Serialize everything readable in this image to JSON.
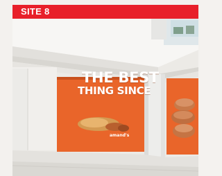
{
  "banner": {
    "label": "SITE 8",
    "color": "#e8202a"
  },
  "advert": {
    "headline_line1": "THE BEST",
    "headline_line2": "THING SINCE",
    "brand": "amand's",
    "color": "#e9652a"
  }
}
